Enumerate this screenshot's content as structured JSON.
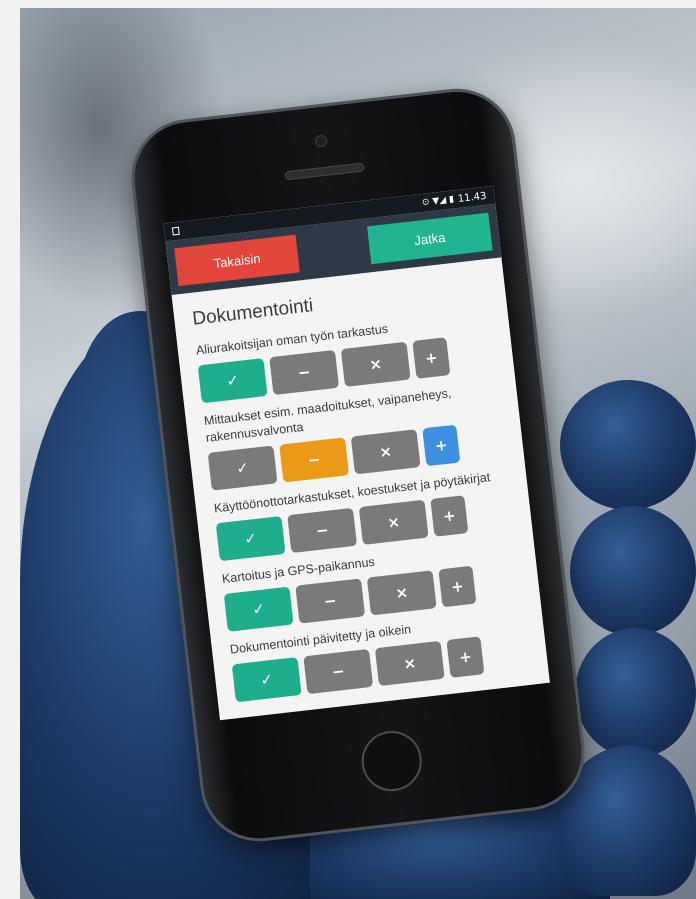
{
  "status_bar": {
    "time": "11.43"
  },
  "topbar": {
    "back_label": "Takaisin",
    "next_label": "Jatka"
  },
  "section_title": "Dokumentointi",
  "symbols": {
    "ok": "✓",
    "minus": "−",
    "cross": "×",
    "plus": "+"
  },
  "items": [
    {
      "label": "Aliurakoitsijan oman työn tarkastus",
      "selected": "ok"
    },
    {
      "label": "Mittaukset esim. maadoitukset, vaipaneheys, rakennusvalvonta",
      "selected": "minus",
      "plus_active": true
    },
    {
      "label": "Käyttöönottotarkastukset, koestukset ja pöytäkirjat",
      "selected": "ok"
    },
    {
      "label": "Kartoitus ja GPS-paikannus",
      "selected": "ok"
    },
    {
      "label": "Dokumentointi päivitetty ja oikein",
      "selected": "ok"
    }
  ],
  "colors": {
    "ok_active": "#1fae8c",
    "minus_active": "#eb9a18",
    "plus_active": "#3d8fe0",
    "inactive": "#7a7a7a",
    "back_button": "#e2463a",
    "next_button": "#22b38f",
    "topbar": "#2e3946"
  }
}
